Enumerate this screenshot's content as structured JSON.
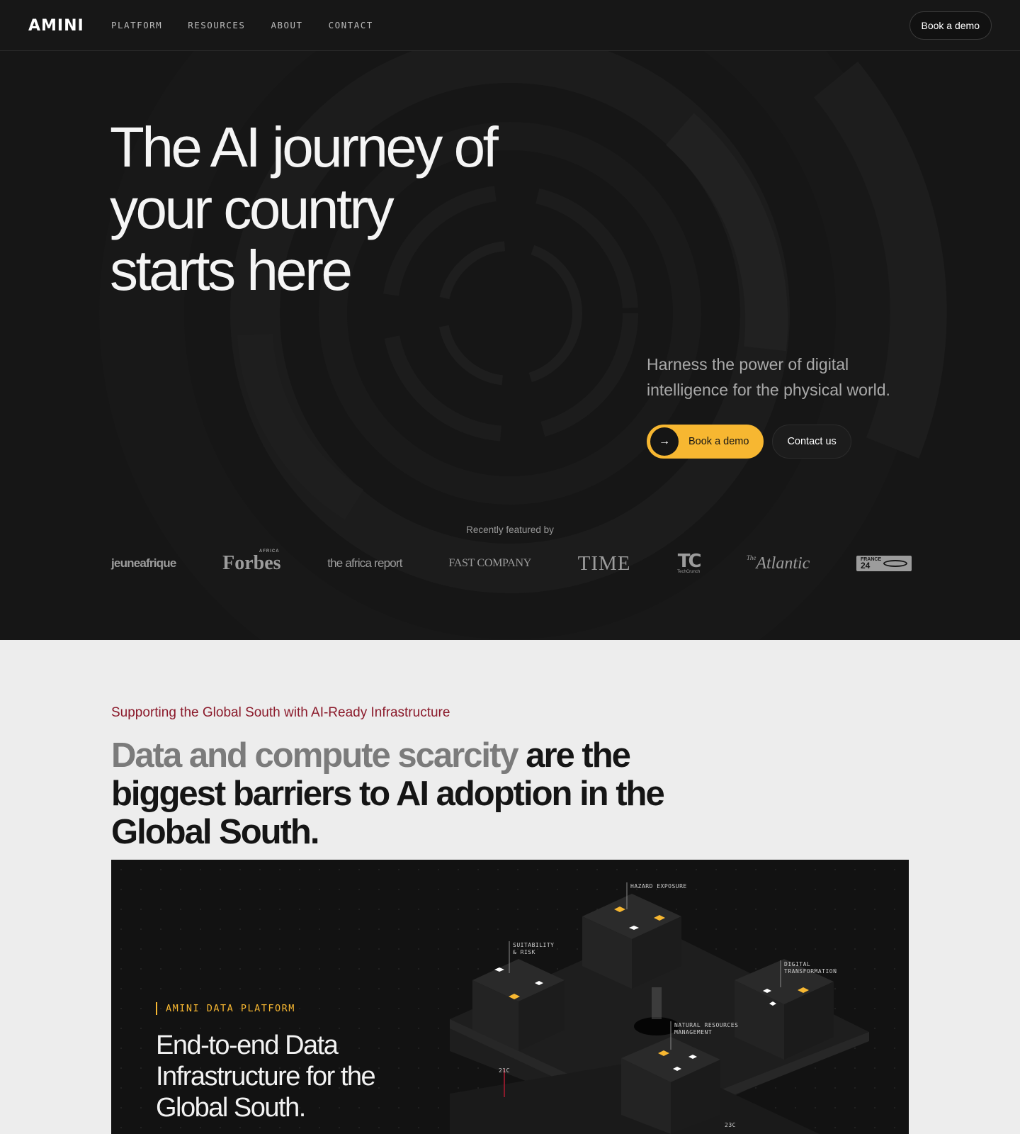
{
  "brand": {
    "logo": "AMINI",
    "accent": "#f7b731",
    "eyebrow_color": "#8b1a2b"
  },
  "nav": {
    "items": [
      "PLATFORM",
      "RESOURCES",
      "ABOUT",
      "CONTACT"
    ],
    "cta": "Book a demo"
  },
  "hero": {
    "title_lines": [
      "The AI journey of",
      "your country",
      "starts here"
    ],
    "subtitle": "Harness the power of digital intelligence for the physical world.",
    "primary_cta": "Book a demo",
    "primary_icon": "arrow-right-icon",
    "secondary_cta": "Contact us",
    "featured_label": "Recently featured by",
    "press": {
      "jeune": "jeuneafrique",
      "forbes": "Forbes",
      "forbes_sub": "AFRICA",
      "africa_report": "the africa report",
      "fastco": "FAST COMPANY",
      "time": "TIME",
      "techcrunch": "TC",
      "techcrunch_sub": "TechCrunch",
      "atlantic": "Atlantic",
      "atlantic_pre": "The",
      "france24_top": "FRANCE",
      "france24_num": "24"
    }
  },
  "section": {
    "eyebrow": "Supporting the Global South with AI-Ready Infrastructure",
    "headline_muted": "Data and compute scarcity",
    "headline_rest": " are the biggest barriers to AI adoption in the Global South."
  },
  "platform": {
    "tag": "AMINI DATA PLATFORM",
    "title": "End-to-end Data Infrastructure for the Global South.",
    "labels": {
      "hazard": "HAZARD EXPOSURE",
      "suitability_1": "SUITABILITY",
      "suitability_2": "& RISK",
      "digital_1": "DIGITAL",
      "digital_2": "TRANSFORMATION",
      "natural_1": "NATURAL RESOURCES",
      "natural_2": "MANAGEMENT",
      "temp_left": "21C",
      "temp_right": "23C"
    }
  }
}
